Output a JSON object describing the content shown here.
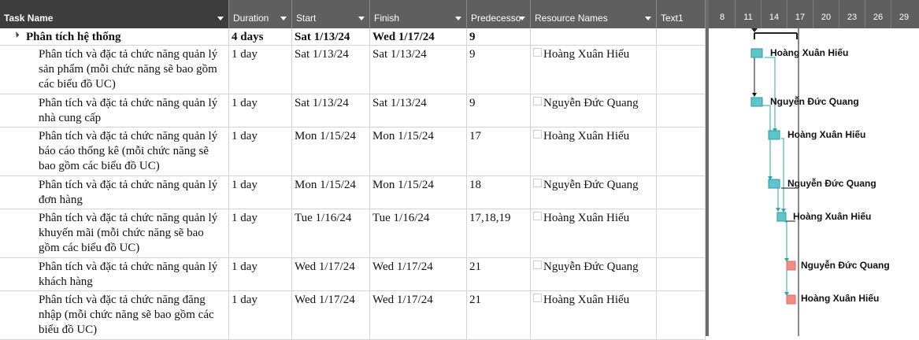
{
  "columns": {
    "task_name": "Task Name",
    "duration": "Duration",
    "start": "Start",
    "finish": "Finish",
    "predecessors": "Predecesso",
    "resource_names": "Resource Names",
    "text1": "Text1"
  },
  "timescale": [
    "8",
    "11",
    "14",
    "17",
    "20",
    "23",
    "26",
    "29"
  ],
  "rows": [
    {
      "name": "Phân tích hệ thống",
      "duration": "4 days",
      "start": "Sat 1/13/24",
      "finish": "Wed 1/17/24",
      "predecessors": "9",
      "resource": ""
    },
    {
      "name": "Phân tích và đặc tả chức năng quản lý sản phẩm (mỗi chức năng sẽ bao gồm các biểu đồ UC)",
      "duration": "1 day",
      "start": "Sat 1/13/24",
      "finish": "Sat 1/13/24",
      "predecessors": "9",
      "resource": "Hoàng Xuân Hiếu"
    },
    {
      "name": "Phân tích và đặc tả chức năng quản lý nhà cung cấp",
      "duration": "1 day",
      "start": "Sat 1/13/24",
      "finish": "Sat 1/13/24",
      "predecessors": "9",
      "resource": "Nguyễn Đức Quang"
    },
    {
      "name": "Phân tích và đặc tả chức năng quản lý báo cáo thống kê (mỗi chức năng sẽ bao gồm các biểu đồ UC)",
      "duration": "1 day",
      "start": "Mon 1/15/24",
      "finish": "Mon 1/15/24",
      "predecessors": "17",
      "resource": "Hoàng Xuân Hiếu"
    },
    {
      "name": "Phân tích và đặc tả chức năng quản lý đơn hàng",
      "duration": "1 day",
      "start": "Mon 1/15/24",
      "finish": "Mon 1/15/24",
      "predecessors": "18",
      "resource": "Nguyễn Đức Quang"
    },
    {
      "name": "Phân tích và đặc tả chức năng quản lý khuyến mãi (mỗi chức năng sẽ bao gồm các biểu đồ UC)",
      "duration": "1 day",
      "start": "Tue 1/16/24",
      "finish": "Tue 1/16/24",
      "predecessors": "17,18,19",
      "resource": "Hoàng Xuân Hiếu"
    },
    {
      "name": "Phân tích và đặc tả chức năng quản lý khách hàng",
      "duration": "1 day",
      "start": "Wed 1/17/24",
      "finish": "Wed 1/17/24",
      "predecessors": "21",
      "resource": "Nguyễn Đức Quang"
    },
    {
      "name": "Phân tích và đặc tả chức năng đăng nhập (mỗi chức năng sẽ bao gồm các biểu đồ UC)",
      "duration": "1 day",
      "start": "Wed 1/17/24",
      "finish": "Wed 1/17/24",
      "predecessors": "21",
      "resource": "Hoàng Xuân Hiếu"
    }
  ],
  "colors": {
    "header_bg": "#5f5f5f",
    "header_first_bg": "#3d3d3d",
    "bar_normal": "#5fc5cc",
    "bar_edge": "#2b9aa1",
    "bar_critical": "#f28b82",
    "link": "#2aa6ae"
  }
}
